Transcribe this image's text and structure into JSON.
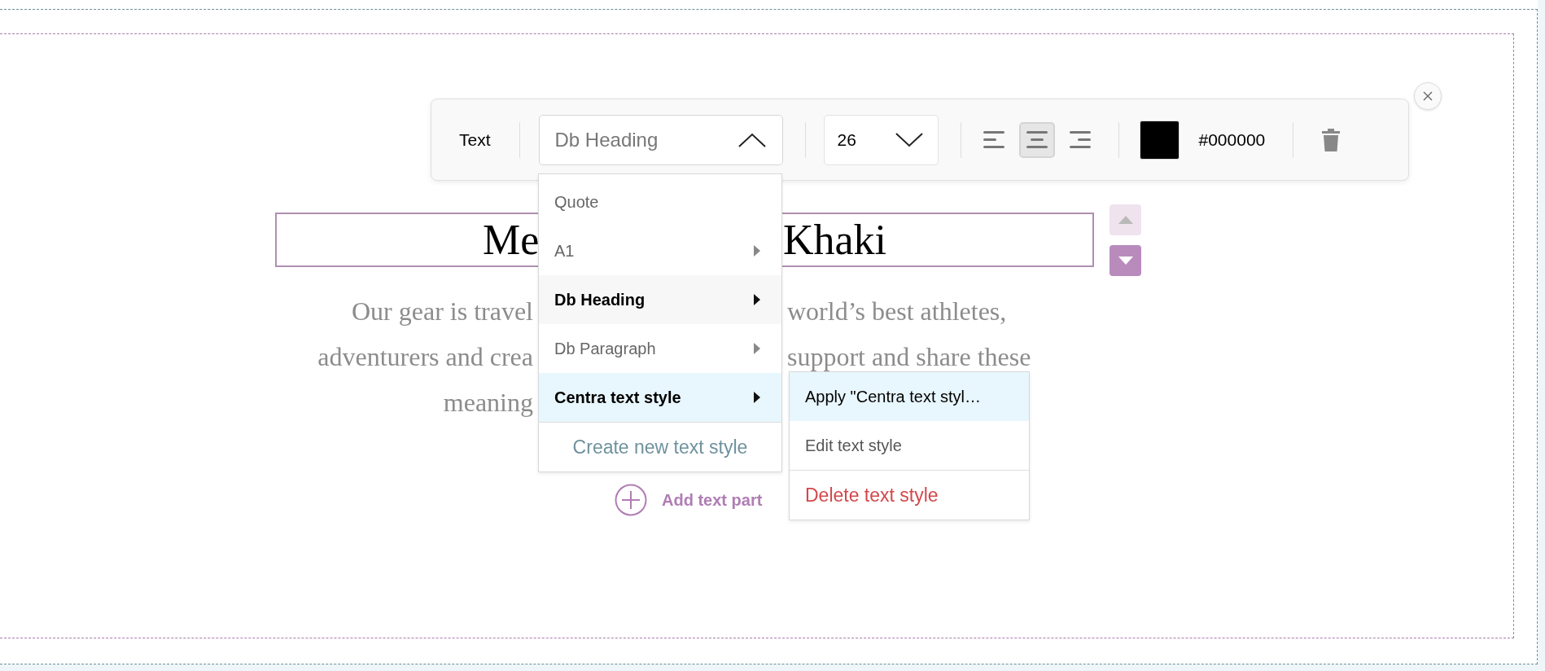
{
  "toolbar": {
    "label": "Text",
    "style_select": {
      "value": "Db Heading",
      "expanded": true
    },
    "size_select": {
      "value": "26",
      "expanded": false
    },
    "align_buttons": [
      {
        "kind": "left",
        "selected": false
      },
      {
        "kind": "center",
        "selected": true
      },
      {
        "kind": "right",
        "selected": false
      }
    ],
    "color": {
      "color": "#000000",
      "hex": "#000000"
    }
  },
  "style_menu": {
    "items": [
      {
        "label": "Quote",
        "submenu": false,
        "current": false,
        "open": false
      },
      {
        "label": "A1",
        "submenu": true,
        "current": false,
        "open": false
      },
      {
        "label": "Db Heading",
        "submenu": true,
        "current": true,
        "open": false
      },
      {
        "label": "Db Paragraph",
        "submenu": true,
        "current": false,
        "open": false
      },
      {
        "label": "Centra text style",
        "submenu": true,
        "current": false,
        "open": true
      }
    ],
    "create": "Create new text style"
  },
  "submenu": {
    "items": [
      {
        "label": "Apply \"Centra text styl…",
        "kind": "normal",
        "highlighted": true
      },
      {
        "label": "Edit text style",
        "kind": "normal",
        "highlighted": false
      },
      {
        "label": "Delete text style",
        "kind": "danger",
        "highlighted": false
      }
    ]
  },
  "heading": {
    "start": "Me",
    "end": "Khaki"
  },
  "paragraph": {
    "lines": [
      {
        "left": "Our gear is travel",
        "right": "world’s best athletes,"
      },
      {
        "left": "adventurers and crea",
        "right": "support and share these"
      },
      {
        "left": "meaning"
      }
    ]
  },
  "add_part": "Add text part"
}
